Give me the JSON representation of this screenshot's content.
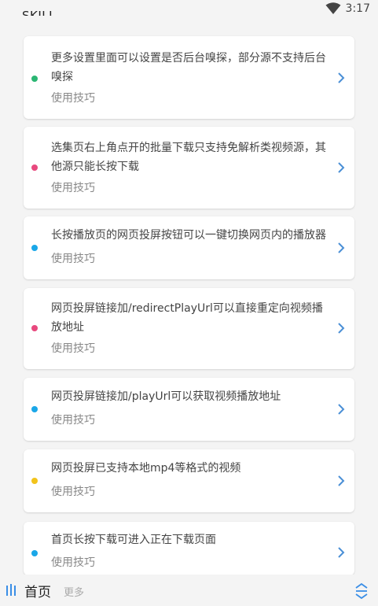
{
  "status": {
    "clipped_header": "SKILL",
    "time": "3:17"
  },
  "cards": [
    {
      "title": "更多设置里面可以设置是否后台嗅探，部分源不支持后台嗅探",
      "subtitle": "使用技巧",
      "dot_color": "#2bb673"
    },
    {
      "title": "选集页右上角点开的批量下载只支持免解析类视频源，其他源只能长按下载",
      "subtitle": "使用技巧",
      "dot_color": "#e8497e"
    },
    {
      "title": "长按播放页的网页投屏按钮可以一键切换网页内的播放器",
      "subtitle": "使用技巧",
      "dot_color": "#1aa7e8"
    },
    {
      "title": "网页投屏链接加/redirectPlayUrl可以直接重定向视频播放地址",
      "subtitle": "使用技巧",
      "dot_color": "#e8497e"
    },
    {
      "title": "网页投屏链接加/playUrl可以获取视频播放地址",
      "subtitle": "使用技巧",
      "dot_color": "#1aa7e8"
    },
    {
      "title": "网页投屏已支持本地mp4等格式的视频",
      "subtitle": "使用技巧",
      "dot_color": "#f2c31b"
    },
    {
      "title": "首页长按下载可进入正在下载页面",
      "subtitle": "使用技巧",
      "dot_color": "#1aa7e8"
    }
  ],
  "bottom": {
    "home": "首页",
    "more": "更多"
  },
  "colors": {
    "accent": "#3a8ee6",
    "chevron": "#4a8fd6"
  }
}
